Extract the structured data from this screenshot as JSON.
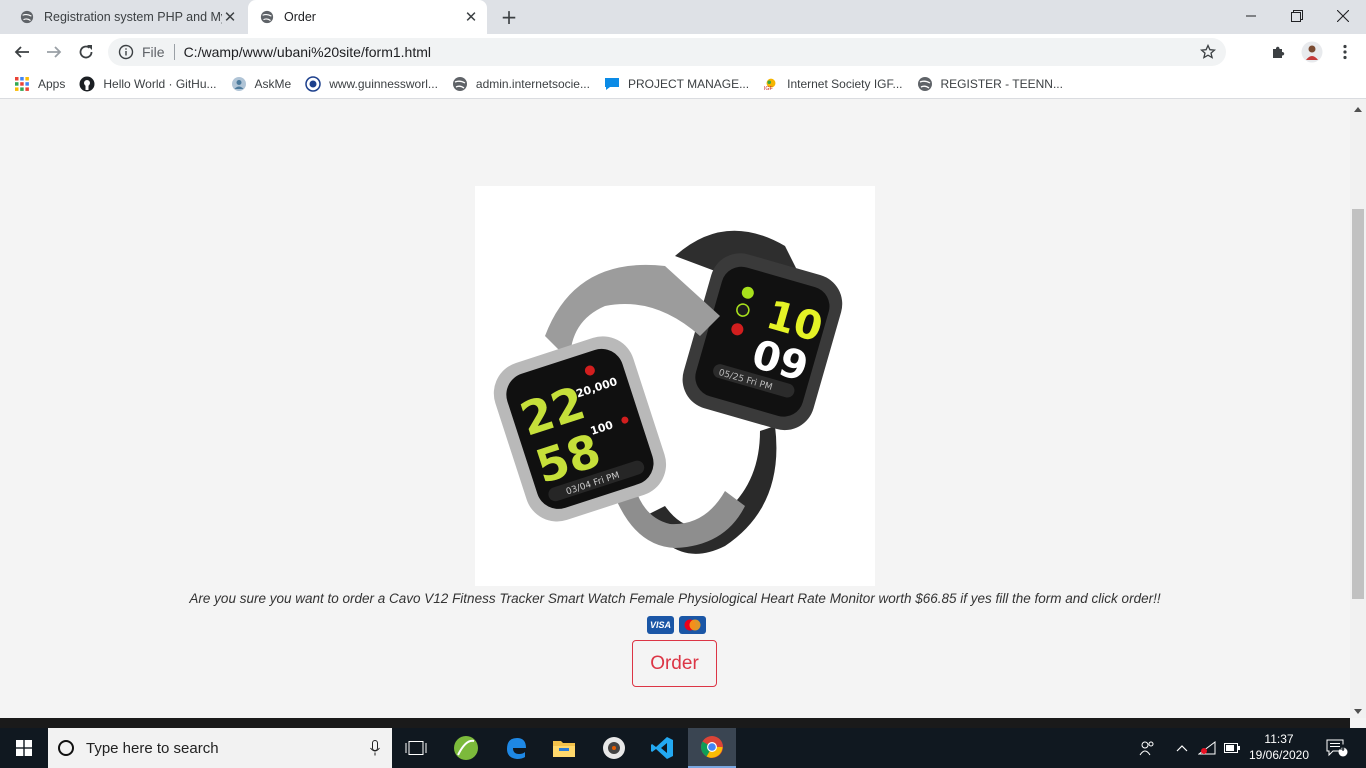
{
  "tabs": [
    {
      "title": "Registration system PHP and My",
      "active": false
    },
    {
      "title": "Order",
      "active": true
    }
  ],
  "toolbar": {
    "scheme_label": "File",
    "url": "C:/wamp/www/ubani%20site/form1.html"
  },
  "bookmarks": [
    {
      "label": "Apps",
      "icon": "apps-grid-icon"
    },
    {
      "label": "Hello World · GitHu...",
      "icon": "github-icon"
    },
    {
      "label": "AskMe",
      "icon": "askme-icon"
    },
    {
      "label": "www.guinnessworl...",
      "icon": "guinness-icon"
    },
    {
      "label": "admin.internetsocie...",
      "icon": "globe-icon"
    },
    {
      "label": "PROJECT MANAGE...",
      "icon": "chat-icon"
    },
    {
      "label": "Internet Society IGF...",
      "icon": "igf-icon"
    },
    {
      "label": "REGISTER - TEENN...",
      "icon": "globe-icon"
    }
  ],
  "page": {
    "question": "Are you sure you want to order a Cavo V12 Fitness Tracker Smart Watch Female Physiological Heart Rate Monitor worth $66.85 if yes fill the form and click order!!",
    "cards": [
      "VISA",
      "mastercard"
    ],
    "order_label": "Order",
    "watch_left": {
      "hour": "22",
      "minute": "58",
      "steps": "20,000",
      "heart": "100",
      "date": "03/04 Fri PM"
    },
    "watch_right": {
      "hour": "10",
      "minute": "09",
      "date": "05/25 Fri PM"
    }
  },
  "taskbar": {
    "search_placeholder": "Type here to search",
    "time": "11:37",
    "date": "19/06/2020",
    "notifications": "4"
  },
  "colors": {
    "order_button": "#dc3545",
    "page_bg": "#f4f4f4",
    "tabstrip_bg": "#dee1e6",
    "taskbar_bg": "#101820"
  }
}
